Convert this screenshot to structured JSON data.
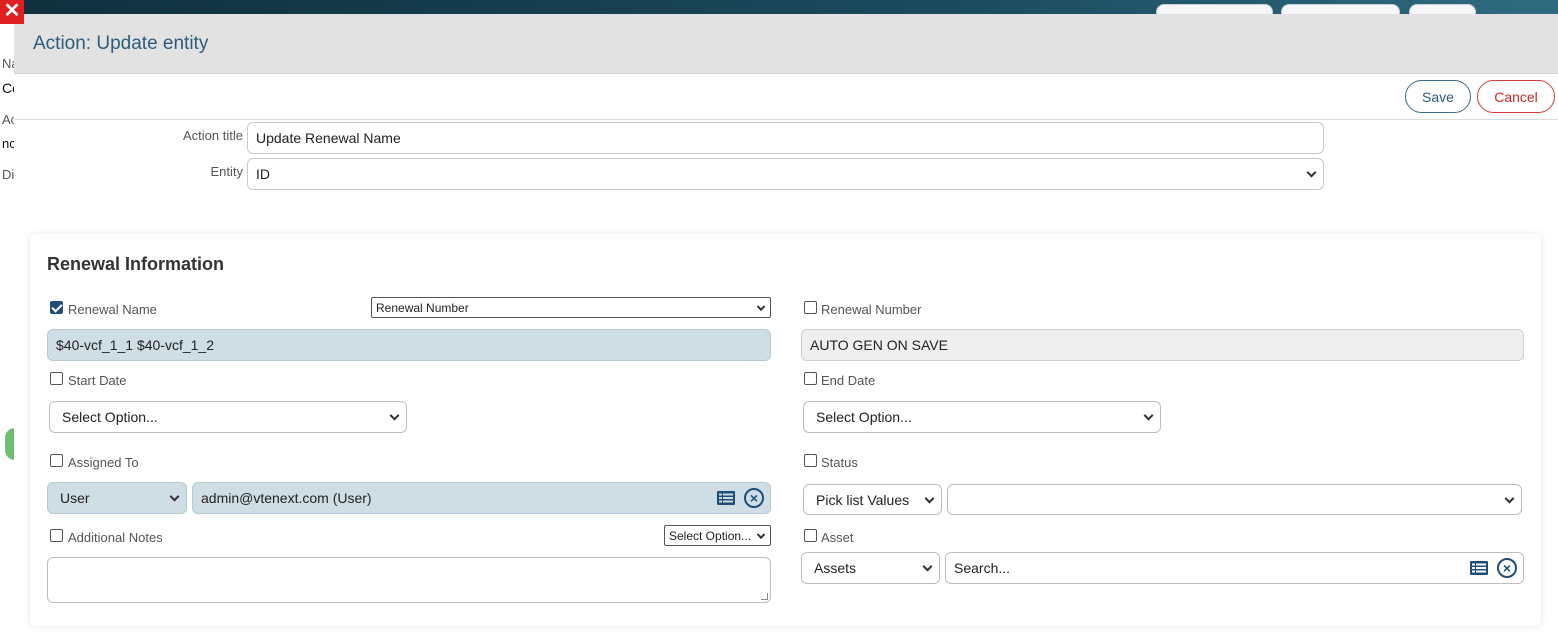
{
  "modal": {
    "title": "Action: Update entity",
    "save_label": "Save",
    "cancel_label": "Cancel"
  },
  "background": {
    "side_letters": [
      "Na",
      "Co",
      "Ac",
      "nc",
      "Di"
    ]
  },
  "form": {
    "action_title_label": "Action title",
    "action_title_value": "Update Renewal Name",
    "entity_label": "Entity",
    "entity_value": "ID"
  },
  "section": {
    "title": "Renewal Information",
    "fields": {
      "renewal_name": {
        "label": "Renewal Name",
        "checked": true,
        "value": "$40-vcf_1_1 $40-vcf_1_2",
        "mapping": "Renewal Number"
      },
      "renewal_number": {
        "label": "Renewal Number",
        "checked": false,
        "value": "AUTO GEN ON SAVE"
      },
      "start_date": {
        "label": "Start Date",
        "checked": false,
        "value": "Select Option..."
      },
      "end_date": {
        "label": "End Date",
        "checked": false,
        "value": "Select Option..."
      },
      "assigned_to": {
        "label": "Assigned To",
        "checked": false,
        "type": "User",
        "value": "admin@vtenext.com (User)"
      },
      "status": {
        "label": "Status",
        "checked": false,
        "type": "Pick list Values",
        "value": ""
      },
      "additional_notes": {
        "label": "Additional Notes",
        "checked": false,
        "mapping": "Select Option...",
        "value": ""
      },
      "asset": {
        "label": "Asset",
        "checked": false,
        "type": "Assets",
        "placeholder": "Search..."
      }
    }
  },
  "colors": {
    "accent": "#1f4e79",
    "cancel": "#d02828",
    "filled_field": "#cfdde4"
  }
}
